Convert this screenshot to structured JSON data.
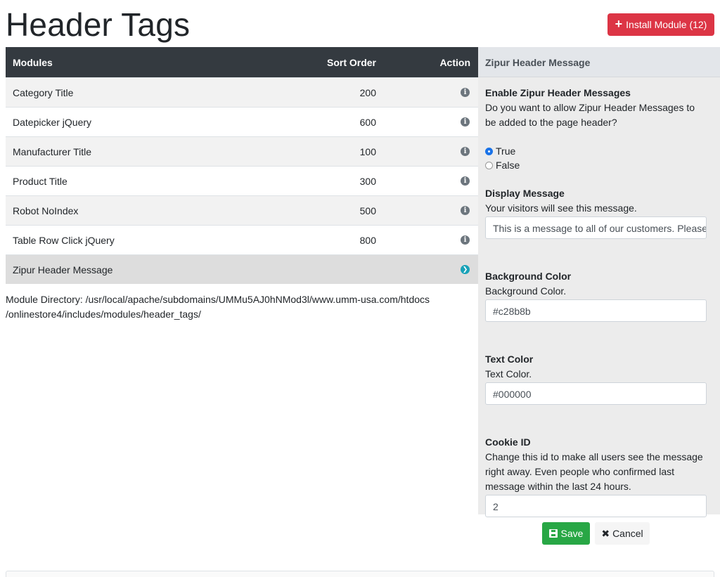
{
  "page": {
    "title": "Header Tags"
  },
  "install_button": {
    "label": "Install Module (12)",
    "icon": "plus-icon"
  },
  "table": {
    "headers": {
      "modules": "Modules",
      "sort_order": "Sort Order",
      "action": "Action"
    },
    "rows": [
      {
        "name": "Category Title",
        "sort": "200",
        "icon": "info-icon"
      },
      {
        "name": "Datepicker jQuery",
        "sort": "600",
        "icon": "info-icon"
      },
      {
        "name": "Manufacturer Title",
        "sort": "100",
        "icon": "info-icon"
      },
      {
        "name": "Product Title",
        "sort": "300",
        "icon": "info-icon"
      },
      {
        "name": "Robot NoIndex",
        "sort": "500",
        "icon": "info-icon"
      },
      {
        "name": "Table Row Click jQuery",
        "sort": "800",
        "icon": "info-icon"
      },
      {
        "name": "Zipur Header Message",
        "sort": "",
        "icon": "chevron-right-circle-icon",
        "selected": true
      }
    ]
  },
  "module_directory": {
    "line1": "Module Directory: /usr/local/apache/subdomains/UMMu5AJ0hNMod3l/www.umm-usa.com/htdocs",
    "line2": "/onlinestore4/includes/modules/header_tags/"
  },
  "panel": {
    "title": "Zipur Header Message",
    "enable": {
      "title": "Enable Zipur Header Messages",
      "desc_line1": "Do you want to allow Zipur Header Messages to",
      "desc_line2": "be added to the page header?",
      "options": [
        "True",
        "False"
      ],
      "selected": "True"
    },
    "display_message": {
      "title": "Display Message",
      "desc": "Your visitors will see this message.",
      "value": "This is a message to all of our customers. Please"
    },
    "background_color": {
      "title": "Background Color",
      "desc": "Background Color.",
      "value": "#c28b8b"
    },
    "text_color": {
      "title": "Text Color",
      "desc": "Text Color.",
      "value": "#000000"
    },
    "cookie_id": {
      "title": "Cookie ID",
      "desc_line1": "Change this id to make all users see the message",
      "desc_line2": "right away. Even people who confirmed last",
      "desc_line3": "message within the last 24 hours.",
      "value": "2"
    }
  },
  "buttons": {
    "save": "Save",
    "cancel": "Cancel"
  },
  "colors": {
    "danger": "#dc3545",
    "success": "#28a745",
    "dark_header": "#343a40",
    "info": "#17a2b8"
  }
}
